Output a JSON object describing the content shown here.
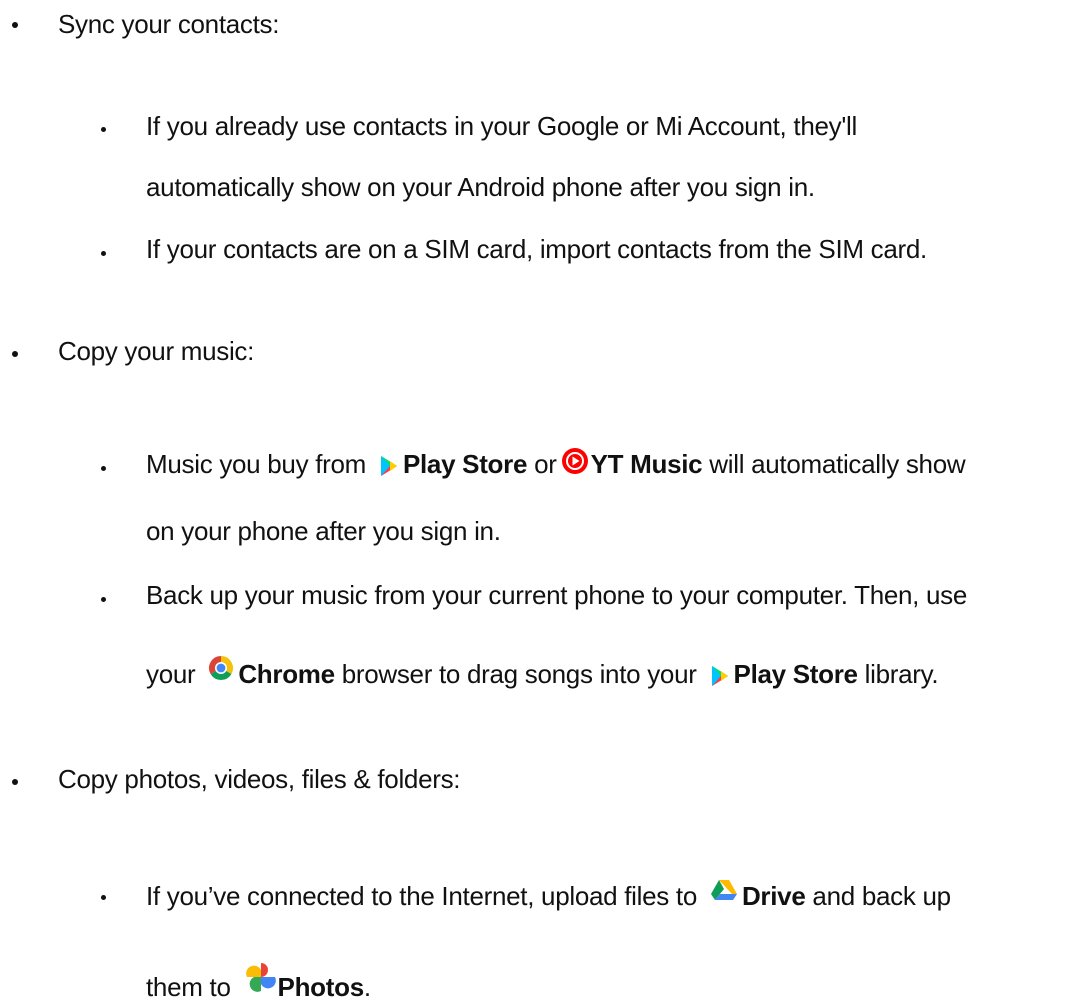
{
  "sections": [
    {
      "heading": "Sync your contacts:",
      "items": [
        {
          "line1": "If you already use contacts in your Google or Mi Account, they'll",
          "line2": "automatically show on your Android phone after you sign in."
        },
        {
          "line1": "If your contacts are on a SIM card, import contacts from the SIM card."
        }
      ]
    },
    {
      "heading": "Copy your music:",
      "items": [
        {
          "pre": "Music you buy from",
          "app1": "Play Store",
          "mid": "or",
          "app2": "YT Music",
          "post": "will automatically show",
          "line2": "on your phone after you sign in."
        },
        {
          "line1": "Back up your music from your current phone to your computer. Then, use",
          "pre2": "your",
          "app1": "Chrome",
          "mid2": "browser to drag songs into your",
          "app2": "Play Store",
          "post2": "library."
        }
      ]
    },
    {
      "heading": "Copy photos, videos, files & folders:",
      "items": [
        {
          "pre": "If you’ve connected to the Internet, upload files to",
          "app1": "Drive",
          "post": "and back up",
          "pre2": "them to",
          "app2": "Photos",
          "post2": "."
        }
      ]
    }
  ],
  "icons": {
    "play_store": "play-store-icon",
    "yt_music": "yt-music-icon",
    "chrome": "chrome-icon",
    "drive": "drive-icon",
    "photos": "photos-icon"
  },
  "colors": {
    "text": "#111111",
    "yt_red": "#ff0000",
    "chrome_red": "#db4437",
    "chrome_yellow": "#f4c20d",
    "chrome_green": "#0f9d58",
    "chrome_blue": "#4285f4"
  }
}
